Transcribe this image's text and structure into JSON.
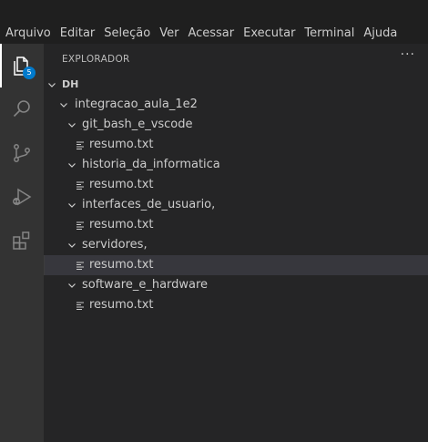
{
  "menu": [
    "Arquivo",
    "Editar",
    "Seleção",
    "Ver",
    "Acessar",
    "Executar",
    "Terminal",
    "Ajuda"
  ],
  "activity": {
    "explorer_badge": "5"
  },
  "sidebar": {
    "title": "EXPLORADOR",
    "more": "···"
  },
  "tree": {
    "root": "DH",
    "project": "integracao_aula_1e2",
    "folders": [
      {
        "name": "git_bash_e_vscode",
        "file": "resumo.txt"
      },
      {
        "name": "historia_da_informatica",
        "file": "resumo.txt"
      },
      {
        "name": "interfaces_de_usuario,",
        "file": "resumo.txt"
      },
      {
        "name": "servidores,",
        "file": "resumo.txt"
      },
      {
        "name": "software_e_hardware",
        "file": "resumo.txt"
      }
    ]
  },
  "colors": {
    "activity_bar": "#333333",
    "sidebar": "#252526",
    "selection": "#37373d",
    "badge": "#007acc"
  }
}
